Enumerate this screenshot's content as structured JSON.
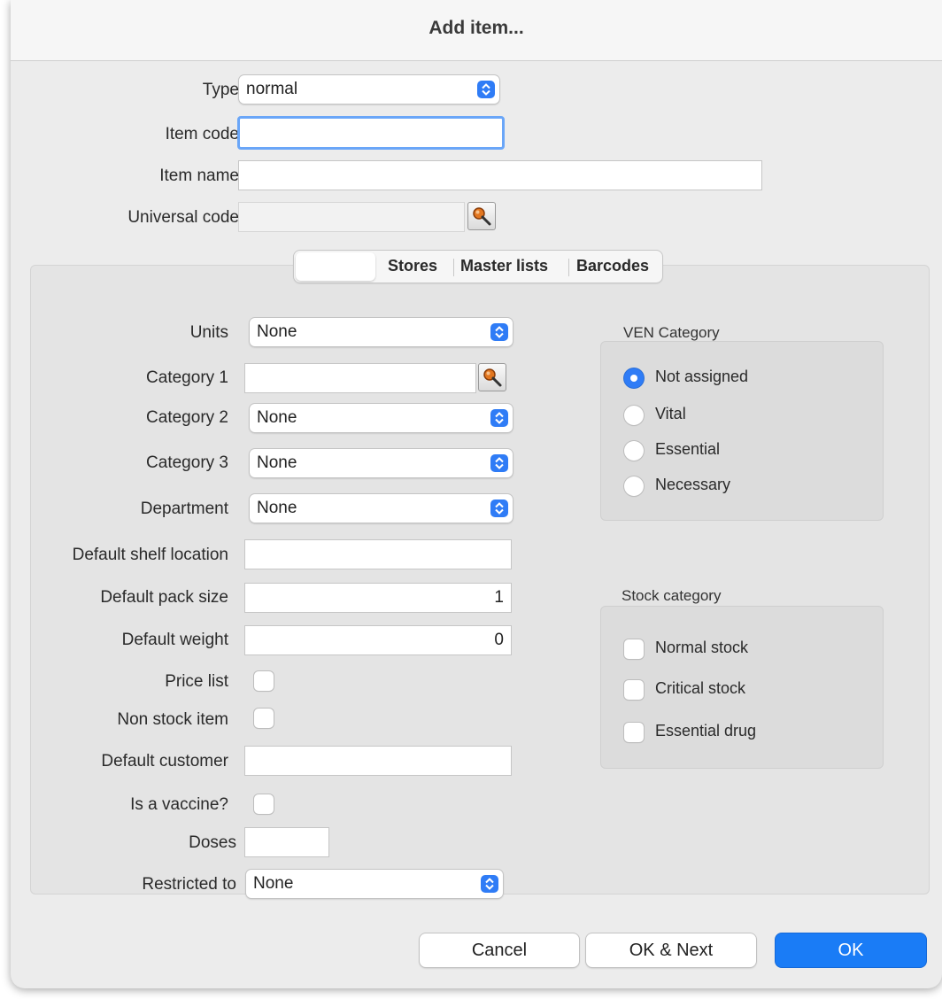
{
  "window": {
    "title": "Add item..."
  },
  "fields": {
    "type": {
      "label": "Type",
      "value": "normal"
    },
    "item_code": {
      "label": "Item code",
      "value": ""
    },
    "item_name": {
      "label": "Item name",
      "value": ""
    },
    "universal_code": {
      "label": "Universal code",
      "value": ""
    }
  },
  "tabs": [
    {
      "label": "",
      "selected": true
    },
    {
      "label": "Stores",
      "selected": false
    },
    {
      "label": "Master lists",
      "selected": false
    },
    {
      "label": "Barcodes",
      "selected": false
    }
  ],
  "general": {
    "units": {
      "label": "Units",
      "value": "None"
    },
    "category1": {
      "label": "Category 1",
      "value": ""
    },
    "category2": {
      "label": "Category 2",
      "value": "None"
    },
    "category3": {
      "label": "Category 3",
      "value": "None"
    },
    "department": {
      "label": "Department",
      "value": "None"
    },
    "shelf_location": {
      "label": "Default shelf location",
      "value": ""
    },
    "pack_size": {
      "label": "Default pack size",
      "value": "1"
    },
    "weight": {
      "label": "Default weight",
      "value": "0"
    },
    "price_list": {
      "label": "Price list",
      "checked": false
    },
    "non_stock": {
      "label": "Non stock item",
      "checked": false
    },
    "customer": {
      "label": "Default customer",
      "value": ""
    },
    "vaccine": {
      "label": "Is a vaccine?",
      "checked": false
    },
    "doses": {
      "label": "Doses",
      "value": ""
    },
    "restricted": {
      "label": "Restricted to",
      "value": "None"
    }
  },
  "ven_category": {
    "title": "VEN Category",
    "options": [
      "Not assigned",
      "Vital",
      "Essential",
      "Necessary"
    ],
    "selected": "Not assigned"
  },
  "stock_category": {
    "title": "Stock category",
    "options": [
      "Normal stock",
      "Critical stock",
      "Essential drug"
    ]
  },
  "buttons": {
    "cancel": "Cancel",
    "ok_next": "OK & Next",
    "ok": "OK"
  },
  "colors": {
    "accent": "#2f7cf6",
    "primary_button": "#1a7cf6"
  },
  "icons": {
    "lookup": "search-magnifier-icon",
    "popup": "stepper-chevrons-icon"
  }
}
